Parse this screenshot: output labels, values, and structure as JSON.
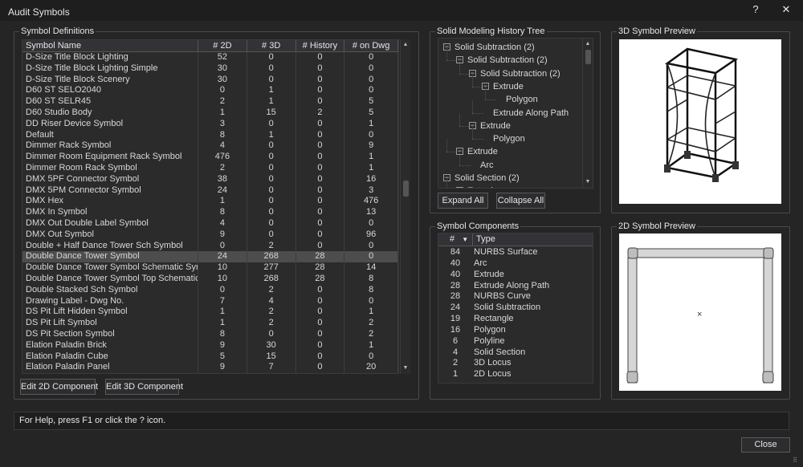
{
  "window": {
    "title": "Audit Symbols",
    "help_label": "?",
    "close_label": "✕"
  },
  "symbol_definitions": {
    "title": "Symbol Definitions",
    "columns": [
      "Symbol Name",
      "# 2D",
      "# 3D",
      "# History",
      "# on Dwg"
    ],
    "rows": [
      [
        "D-Size Title Block Lighting",
        "52",
        "0",
        "0",
        "0"
      ],
      [
        "D-Size Title Block Lighting Simple",
        "30",
        "0",
        "0",
        "0"
      ],
      [
        "D-Size Title Block Scenery",
        "30",
        "0",
        "0",
        "0"
      ],
      [
        "D60 ST SELO2040",
        "0",
        "1",
        "0",
        "0"
      ],
      [
        "D60 ST SELR45",
        "2",
        "1",
        "0",
        "5"
      ],
      [
        "D60 Studio Body",
        "1",
        "15",
        "2",
        "5"
      ],
      [
        "DD Riser Device Symbol",
        "3",
        "0",
        "0",
        "1"
      ],
      [
        "Default",
        "8",
        "1",
        "0",
        "0"
      ],
      [
        "Dimmer Rack Symbol",
        "4",
        "0",
        "0",
        "9"
      ],
      [
        "Dimmer Room Equipment Rack Symbol",
        "476",
        "0",
        "0",
        "1"
      ],
      [
        "Dimmer Room Rack Symbol",
        "2",
        "0",
        "0",
        "1"
      ],
      [
        "DMX 5PF Connector Symbol",
        "38",
        "0",
        "0",
        "16"
      ],
      [
        "DMX 5PM Connector Symbol",
        "24",
        "0",
        "0",
        "3"
      ],
      [
        "DMX Hex",
        "1",
        "0",
        "0",
        "476"
      ],
      [
        "DMX In Symbol",
        "8",
        "0",
        "0",
        "13"
      ],
      [
        "DMX Out Double Label Symbol",
        "4",
        "0",
        "0",
        "0"
      ],
      [
        "DMX Out Symbol",
        "9",
        "0",
        "0",
        "96"
      ],
      [
        "Double + Half Dance Tower Sch Symbol",
        "0",
        "2",
        "0",
        "0"
      ],
      [
        "Double Dance Tower Symbol",
        "24",
        "268",
        "28",
        "0"
      ],
      [
        "Double Dance Tower Symbol Schematic Symbol",
        "10",
        "277",
        "28",
        "14"
      ],
      [
        "Double Dance Tower Symbol Top Schematic Symbol",
        "10",
        "268",
        "28",
        "8"
      ],
      [
        "Double Stacked Sch Symbol",
        "0",
        "2",
        "0",
        "8"
      ],
      [
        "Drawing Label - Dwg No.",
        "7",
        "4",
        "0",
        "0"
      ],
      [
        "DS Pit Lift Hidden Symbol",
        "1",
        "2",
        "0",
        "1"
      ],
      [
        "DS Pit Lift Symbol",
        "1",
        "2",
        "0",
        "2"
      ],
      [
        "DS Pit Section Symbol",
        "8",
        "0",
        "0",
        "2"
      ],
      [
        "Elation Paladin Brick",
        "9",
        "30",
        "0",
        "1"
      ],
      [
        "Elation Paladin Cube",
        "5",
        "15",
        "0",
        "0"
      ],
      [
        "Elation Paladin Panel",
        "9",
        "7",
        "0",
        "20"
      ]
    ],
    "selected_index": 18,
    "edit_2d_label": "Edit 2D Component",
    "edit_3d_label": "Edit 3D Component"
  },
  "history_tree": {
    "title": "Solid Modeling History Tree",
    "nodes": [
      {
        "label": "Solid Subtraction (2)",
        "level": 0,
        "expander": "−"
      },
      {
        "label": "Solid Subtraction (2)",
        "level": 1,
        "expander": "−"
      },
      {
        "label": "Solid Subtraction (2)",
        "level": 2,
        "expander": "−"
      },
      {
        "label": "Extrude",
        "level": 3,
        "expander": "−"
      },
      {
        "label": "Polygon",
        "level": 4,
        "expander": ""
      },
      {
        "label": "Extrude Along Path",
        "level": 3,
        "expander": ""
      },
      {
        "label": "Extrude",
        "level": 2,
        "expander": "−"
      },
      {
        "label": "Polygon",
        "level": 3,
        "expander": ""
      },
      {
        "label": "Extrude",
        "level": 1,
        "expander": "−"
      },
      {
        "label": "Arc",
        "level": 2,
        "expander": ""
      },
      {
        "label": "Solid Section (2)",
        "level": 0,
        "expander": "−"
      },
      {
        "label": "Extrude",
        "level": 1,
        "expander": "−"
      }
    ],
    "expand_all_label": "Expand All",
    "collapse_all_label": "Collapse All"
  },
  "preview_3d": {
    "title": "3D Symbol Preview"
  },
  "components": {
    "title": "Symbol Components",
    "columns": [
      "#",
      "Type"
    ],
    "rows": [
      [
        "84",
        "NURBS Surface"
      ],
      [
        "40",
        "Arc"
      ],
      [
        "40",
        "Extrude"
      ],
      [
        "28",
        "Extrude Along Path"
      ],
      [
        "28",
        "NURBS Curve"
      ],
      [
        "24",
        "Solid Subtraction"
      ],
      [
        "19",
        "Rectangle"
      ],
      [
        "16",
        "Polygon"
      ],
      [
        "6",
        "Polyline"
      ],
      [
        "4",
        "Solid Section"
      ],
      [
        "2",
        "3D Locus"
      ],
      [
        "1",
        "2D Locus"
      ]
    ]
  },
  "preview_2d": {
    "title": "2D Symbol Preview",
    "locus_mark": "×"
  },
  "status": {
    "text": "For Help, press F1 or click the ? icon."
  },
  "close_button_label": "Close",
  "colors": {
    "background": "#252526",
    "selected_row": "#4d4d4d",
    "preview_bg": "#ffffff"
  }
}
